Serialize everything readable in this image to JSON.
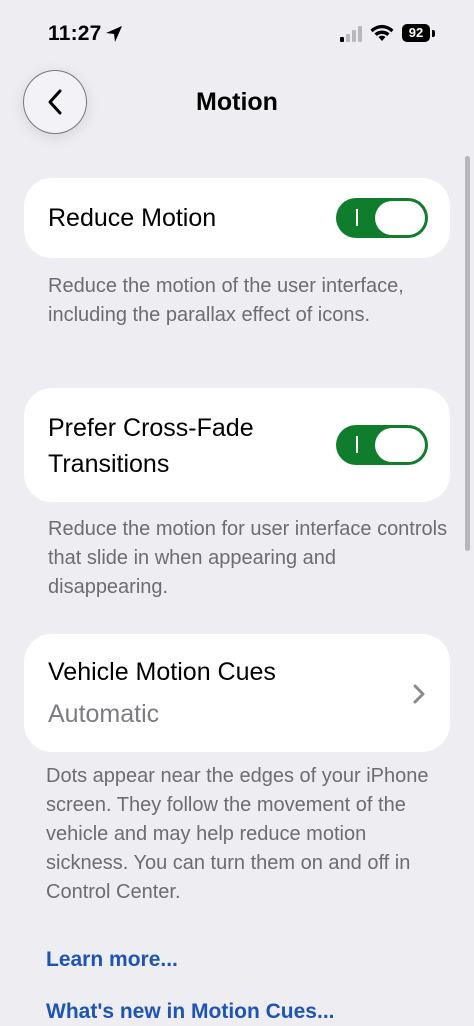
{
  "status_bar": {
    "time": "11:27",
    "battery": "92",
    "icons": [
      "location-arrow-icon",
      "cellular-signal-icon",
      "wifi-icon",
      "battery-icon"
    ]
  },
  "nav": {
    "title": "Motion",
    "back_icon": "chevron-left-icon"
  },
  "settings": {
    "reduce_motion": {
      "label": "Reduce Motion",
      "on": true,
      "footnote": "Reduce the motion of the user interface, including the parallax effect of icons."
    },
    "cross_fade": {
      "label": "Prefer Cross-Fade Transitions",
      "on": true,
      "footnote": "Reduce the motion for user interface controls that slide in when appearing and disappearing."
    },
    "vehicle_motion_cues": {
      "label": "Vehicle Motion Cues",
      "value": "Automatic",
      "footnote": "Dots appear near the edges of your iPhone screen. They follow the movement of the vehicle and may help reduce motion sickness. You can turn them on and off in Control Center."
    }
  },
  "links": {
    "learn_more": "Learn more...",
    "whats_new": "What's new in Motion Cues..."
  },
  "colors": {
    "toggle_on": "#0f7d2c",
    "link": "#1e54b3",
    "background": "#eeedf2"
  }
}
